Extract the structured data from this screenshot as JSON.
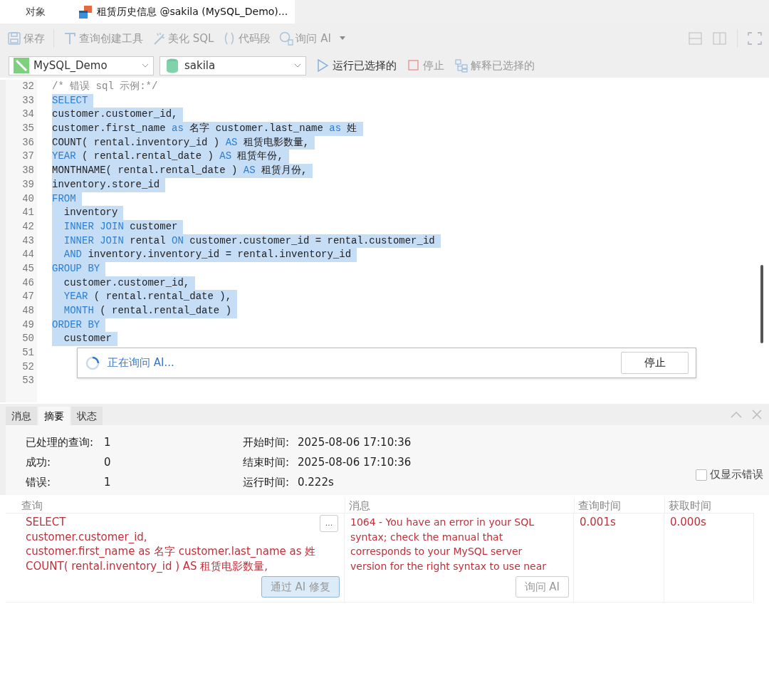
{
  "document_tabs": [
    {
      "label": "对象",
      "kind": "plain",
      "selected": false
    },
    {
      "label": "租赁历史信息 @sakila (MySQL_Demo)...",
      "kind": "query",
      "selected": true
    }
  ],
  "toolbar": [
    {
      "label": "保存",
      "kind": "save",
      "disabled": true
    },
    {
      "label": "查询创建工具",
      "kind": "builder",
      "disabled": true
    },
    {
      "label": "美化 SQL",
      "kind": "beautify",
      "disabled": true
    },
    {
      "label": "代码段",
      "kind": "snippet",
      "disabled": true
    },
    {
      "label": "询问 AI",
      "kind": "ai",
      "disabled": true
    }
  ],
  "connection": {
    "value": "MySQL_Demo"
  },
  "database": {
    "value": "sakila"
  },
  "actions": [
    {
      "label": "运行已选择的",
      "kind": "run",
      "disabled": false
    },
    {
      "label": "停止",
      "kind": "stop",
      "disabled": true
    },
    {
      "label": "解释已选择的",
      "kind": "explain",
      "disabled": true
    }
  ],
  "editor": {
    "lines": [
      {
        "number": "32",
        "selected": false,
        "tokens": [
          {
            "kind": "comment",
            "text": "/* 错误 sql 示例:*/"
          }
        ]
      },
      {
        "number": "33",
        "selected": true,
        "tokens": [
          {
            "kind": "keyword",
            "text": "SELECT"
          }
        ]
      },
      {
        "number": "34",
        "selected": true,
        "tokens": [
          {
            "kind": "text",
            "text": "customer.customer_id,"
          }
        ]
      },
      {
        "number": "35",
        "selected": true,
        "tokens": [
          {
            "kind": "text",
            "text": "customer.first_name "
          },
          {
            "kind": "keyword",
            "text": "as"
          },
          {
            "kind": "text",
            "text": " 名字 customer.last_name "
          },
          {
            "kind": "keyword",
            "text": "as"
          },
          {
            "kind": "text",
            "text": " 姓"
          }
        ]
      },
      {
        "number": "36",
        "selected": true,
        "tokens": [
          {
            "kind": "text",
            "text": "COUNT( rental.inventory_id ) "
          },
          {
            "kind": "keyword",
            "text": "AS"
          },
          {
            "kind": "text",
            "text": " 租赁电影数量,"
          }
        ]
      },
      {
        "number": "37",
        "selected": true,
        "tokens": [
          {
            "kind": "keyword",
            "text": "YEAR"
          },
          {
            "kind": "text",
            "text": " ( rental.rental_date ) "
          },
          {
            "kind": "keyword",
            "text": "AS"
          },
          {
            "kind": "text",
            "text": " 租赁年份,"
          }
        ]
      },
      {
        "number": "38",
        "selected": true,
        "tokens": [
          {
            "kind": "text",
            "text": "MONTHNAME( rental.rental_date ) "
          },
          {
            "kind": "keyword",
            "text": "AS"
          },
          {
            "kind": "text",
            "text": " 租赁月份,"
          }
        ]
      },
      {
        "number": "39",
        "selected": true,
        "tokens": [
          {
            "kind": "text",
            "text": "inventory.store_id"
          }
        ]
      },
      {
        "number": "40",
        "selected": true,
        "tokens": [
          {
            "kind": "keyword",
            "text": "FROM"
          }
        ]
      },
      {
        "number": "41",
        "selected": true,
        "tokens": [
          {
            "kind": "text",
            "text": "  inventory"
          }
        ]
      },
      {
        "number": "42",
        "selected": true,
        "tokens": [
          {
            "kind": "keyword",
            "text": "  INNER JOIN"
          },
          {
            "kind": "text",
            "text": " customer"
          }
        ]
      },
      {
        "number": "43",
        "selected": true,
        "tokens": [
          {
            "kind": "keyword",
            "text": "  INNER JOIN"
          },
          {
            "kind": "text",
            "text": " rental "
          },
          {
            "kind": "keyword",
            "text": "ON"
          },
          {
            "kind": "text",
            "text": " customer.customer_id = rental.customer_id"
          }
        ]
      },
      {
        "number": "44",
        "selected": true,
        "tokens": [
          {
            "kind": "keyword",
            "text": "  AND"
          },
          {
            "kind": "text",
            "text": " inventory.inventory_id = rental.inventory_id"
          }
        ]
      },
      {
        "number": "45",
        "selected": true,
        "tokens": [
          {
            "kind": "keyword",
            "text": "GROUP BY"
          }
        ]
      },
      {
        "number": "46",
        "selected": true,
        "tokens": [
          {
            "kind": "text",
            "text": "  customer.customer_id,"
          }
        ]
      },
      {
        "number": "47",
        "selected": true,
        "tokens": [
          {
            "kind": "keyword",
            "text": "  YEAR"
          },
          {
            "kind": "text",
            "text": " ( rental.rental_date ),"
          }
        ]
      },
      {
        "number": "48",
        "selected": true,
        "tokens": [
          {
            "kind": "keyword",
            "text": "  MONTH"
          },
          {
            "kind": "text",
            "text": " ( rental.rental_date )"
          }
        ]
      },
      {
        "number": "49",
        "selected": true,
        "tokens": [
          {
            "kind": "keyword",
            "text": "ORDER BY"
          }
        ]
      },
      {
        "number": "50",
        "selected": true,
        "tokens": [
          {
            "kind": "text",
            "text": "  customer"
          }
        ]
      },
      {
        "number": "51"
      },
      {
        "number": "52"
      },
      {
        "number": "53"
      }
    ]
  },
  "ai_popup": {
    "message": "正在询问 AI...",
    "button": "停止"
  },
  "result_tabs": [
    {
      "label": "消息",
      "selected": false
    },
    {
      "label": "摘要",
      "selected": true
    },
    {
      "label": "状态",
      "selected": false
    }
  ],
  "summary": {
    "left": [
      {
        "label": "已处理的查询:",
        "value": "1"
      },
      {
        "label": "成功:",
        "value": "0"
      },
      {
        "label": "错误:",
        "value": "1"
      }
    ],
    "right": [
      {
        "label": "开始时间:",
        "value": "2025-08-06 17:10:36"
      },
      {
        "label": "结束时间:",
        "value": "2025-08-06 17:10:36"
      },
      {
        "label": "运行时间:",
        "value": "0.222s"
      }
    ],
    "errors_only": {
      "label": "仅显示错误",
      "checked": false
    }
  },
  "table": {
    "columns": [
      "查询",
      "消息",
      "查询时间",
      "获取时间"
    ],
    "rows": [
      {
        "query": [
          "SELECT",
          "customer.customer_id,",
          "customer.first_name as 名字 customer.last_name as 姓",
          "COUNT( rental.inventory_id ) AS 租赁电影数量,"
        ],
        "more_button": "...",
        "fix_button": {
          "label": "通过 AI 修复",
          "highlighted": true
        },
        "message": [
          "1064 - You have an error in your SQL",
          "syntax; check the manual that",
          "corresponds to your MySQL server",
          "version for the right syntax to use near"
        ],
        "ask_button": {
          "label": "询问 AI",
          "highlighted": false
        },
        "query_time": "0.001s",
        "fetch_time": "0.000s"
      }
    ]
  }
}
